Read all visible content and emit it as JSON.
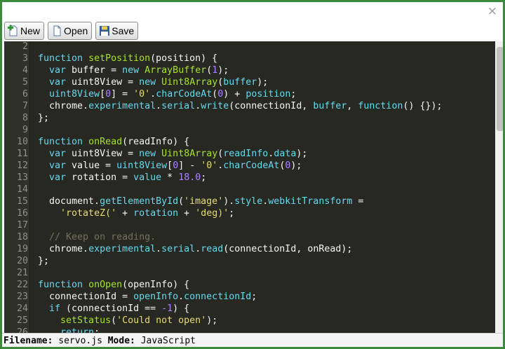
{
  "window": {
    "close_glyph": "×"
  },
  "toolbar": {
    "new_label": "New",
    "open_label": "Open",
    "save_label": "Save",
    "new_icon": "new-file-plus-icon",
    "open_icon": "open-document-icon",
    "save_icon": "floppy-disk-icon"
  },
  "theme": {
    "background": "#272822",
    "text": "#f8f8f2",
    "keyword": "#66d9ef",
    "function_name": "#a6e22e",
    "string": "#e6db74",
    "number": "#ae81ff",
    "property": "#66d9ef",
    "comment": "#75715e",
    "gutter_text": "#8f908a"
  },
  "editor": {
    "lines": [
      {
        "num": "2",
        "tokens": []
      },
      {
        "num": "3",
        "tokens": [
          [
            "kw",
            "function"
          ],
          [
            "t",
            " "
          ],
          [
            "fn",
            "setPosition"
          ],
          [
            "t",
            "(position) {"
          ]
        ]
      },
      {
        "num": "4",
        "tokens": [
          [
            "t",
            "  "
          ],
          [
            "kw",
            "var"
          ],
          [
            "t",
            " buffer = "
          ],
          [
            "kw",
            "new"
          ],
          [
            "t",
            " "
          ],
          [
            "fn",
            "ArrayBuffer"
          ],
          [
            "t",
            "("
          ],
          [
            "num",
            "1"
          ],
          [
            "t",
            ");"
          ]
        ]
      },
      {
        "num": "5",
        "tokens": [
          [
            "t",
            "  "
          ],
          [
            "kw",
            "var"
          ],
          [
            "t",
            " uint8View = "
          ],
          [
            "kw",
            "new"
          ],
          [
            "t",
            " "
          ],
          [
            "fn",
            "Uint8Array"
          ],
          [
            "t",
            "("
          ],
          [
            "prop",
            "buffer"
          ],
          [
            "t",
            ");"
          ]
        ]
      },
      {
        "num": "6",
        "tokens": [
          [
            "t",
            "  "
          ],
          [
            "prop",
            "uint8View"
          ],
          [
            "t",
            "["
          ],
          [
            "num",
            "0"
          ],
          [
            "t",
            "] = "
          ],
          [
            "str",
            "'0'"
          ],
          [
            "t",
            "."
          ],
          [
            "prop",
            "charCodeAt"
          ],
          [
            "t",
            "("
          ],
          [
            "num",
            "0"
          ],
          [
            "t",
            ") + "
          ],
          [
            "prop",
            "position"
          ],
          [
            "t",
            ";"
          ]
        ]
      },
      {
        "num": "7",
        "tokens": [
          [
            "t",
            "  chrome."
          ],
          [
            "prop",
            "experimental"
          ],
          [
            "t",
            "."
          ],
          [
            "prop",
            "serial"
          ],
          [
            "t",
            "."
          ],
          [
            "prop",
            "write"
          ],
          [
            "t",
            "(connectionId, "
          ],
          [
            "prop",
            "buffer"
          ],
          [
            "t",
            ", "
          ],
          [
            "kw",
            "function"
          ],
          [
            "t",
            "() {});"
          ]
        ]
      },
      {
        "num": "8",
        "tokens": [
          [
            "t",
            "};"
          ]
        ]
      },
      {
        "num": "9",
        "tokens": []
      },
      {
        "num": "10",
        "tokens": [
          [
            "kw",
            "function"
          ],
          [
            "t",
            " "
          ],
          [
            "fn",
            "onRead"
          ],
          [
            "t",
            "(readInfo) {"
          ]
        ]
      },
      {
        "num": "11",
        "tokens": [
          [
            "t",
            "  "
          ],
          [
            "kw",
            "var"
          ],
          [
            "t",
            " uint8View = "
          ],
          [
            "kw",
            "new"
          ],
          [
            "t",
            " "
          ],
          [
            "fn",
            "Uint8Array"
          ],
          [
            "t",
            "("
          ],
          [
            "prop",
            "readInfo"
          ],
          [
            "t",
            "."
          ],
          [
            "prop",
            "data"
          ],
          [
            "t",
            ");"
          ]
        ]
      },
      {
        "num": "12",
        "tokens": [
          [
            "t",
            "  "
          ],
          [
            "kw",
            "var"
          ],
          [
            "t",
            " value = "
          ],
          [
            "prop",
            "uint8View"
          ],
          [
            "t",
            "["
          ],
          [
            "num",
            "0"
          ],
          [
            "t",
            "] - "
          ],
          [
            "str",
            "'0'"
          ],
          [
            "t",
            "."
          ],
          [
            "prop",
            "charCodeAt"
          ],
          [
            "t",
            "("
          ],
          [
            "num",
            "0"
          ],
          [
            "t",
            ");"
          ]
        ]
      },
      {
        "num": "13",
        "tokens": [
          [
            "t",
            "  "
          ],
          [
            "kw",
            "var"
          ],
          [
            "t",
            " rotation = "
          ],
          [
            "prop",
            "value"
          ],
          [
            "t",
            " * "
          ],
          [
            "num",
            "18.0"
          ],
          [
            "t",
            ";"
          ]
        ]
      },
      {
        "num": "14",
        "tokens": []
      },
      {
        "num": "15",
        "tokens": [
          [
            "t",
            "  document."
          ],
          [
            "prop",
            "getElementById"
          ],
          [
            "t",
            "("
          ],
          [
            "str",
            "'image'"
          ],
          [
            "t",
            ")."
          ],
          [
            "prop",
            "style"
          ],
          [
            "t",
            "."
          ],
          [
            "prop",
            "webkitTransform"
          ],
          [
            "t",
            " ="
          ]
        ]
      },
      {
        "num": "16",
        "tokens": [
          [
            "t",
            "    "
          ],
          [
            "str",
            "'rotateZ('"
          ],
          [
            "t",
            " + "
          ],
          [
            "prop",
            "rotation"
          ],
          [
            "t",
            " + "
          ],
          [
            "str",
            "'deg)'"
          ],
          [
            "t",
            ";"
          ]
        ]
      },
      {
        "num": "17",
        "tokens": []
      },
      {
        "num": "18",
        "tokens": [
          [
            "t",
            "  "
          ],
          [
            "cm",
            "// Keep on reading."
          ]
        ]
      },
      {
        "num": "19",
        "tokens": [
          [
            "t",
            "  chrome."
          ],
          [
            "prop",
            "experimental"
          ],
          [
            "t",
            "."
          ],
          [
            "prop",
            "serial"
          ],
          [
            "t",
            "."
          ],
          [
            "prop",
            "read"
          ],
          [
            "t",
            "(connectionId, onRead);"
          ]
        ]
      },
      {
        "num": "20",
        "tokens": [
          [
            "t",
            "};"
          ]
        ]
      },
      {
        "num": "21",
        "tokens": []
      },
      {
        "num": "22",
        "tokens": [
          [
            "kw",
            "function"
          ],
          [
            "t",
            " "
          ],
          [
            "fn",
            "onOpen"
          ],
          [
            "t",
            "(openInfo) {"
          ]
        ]
      },
      {
        "num": "23",
        "tokens": [
          [
            "t",
            "  connectionId = "
          ],
          [
            "prop",
            "openInfo"
          ],
          [
            "t",
            "."
          ],
          [
            "prop",
            "connectionId"
          ],
          [
            "t",
            ";"
          ]
        ]
      },
      {
        "num": "24",
        "tokens": [
          [
            "t",
            "  "
          ],
          [
            "kw",
            "if"
          ],
          [
            "t",
            " (connectionId == "
          ],
          [
            "num",
            "-1"
          ],
          [
            "t",
            ") {"
          ]
        ]
      },
      {
        "num": "25",
        "tokens": [
          [
            "t",
            "    "
          ],
          [
            "fn",
            "setStatus"
          ],
          [
            "t",
            "("
          ],
          [
            "str",
            "'Could not open'"
          ],
          [
            "t",
            ");"
          ]
        ]
      },
      {
        "num": "26",
        "tokens": [
          [
            "t",
            "    "
          ],
          [
            "kw",
            "return"
          ],
          [
            "t",
            ";"
          ]
        ]
      }
    ]
  },
  "statusbar": {
    "filename_label": "Filename:",
    "filename_value": "servo.js",
    "mode_label": "Mode:",
    "mode_value": "JavaScript"
  }
}
